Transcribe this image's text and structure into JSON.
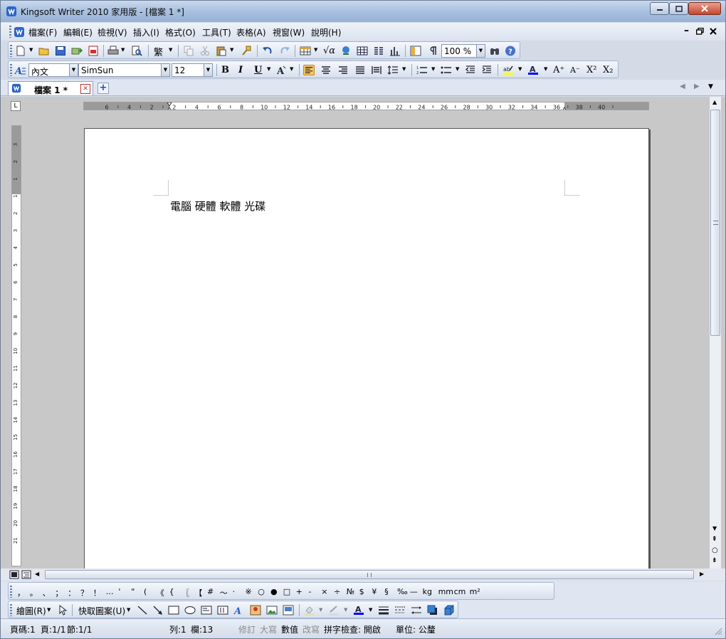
{
  "window": {
    "title": "Kingsoft Writer 2010 家用版 - [檔案 1 *]"
  },
  "menu": {
    "items": [
      "檔案(F)",
      "編輯(E)",
      "檢視(V)",
      "插入(I)",
      "格式(O)",
      "工具(T)",
      "表格(A)",
      "視窗(W)",
      "說明(H)"
    ]
  },
  "toolbar": {
    "zoom": "100 %",
    "trad_label": "繁"
  },
  "format": {
    "style": "內文",
    "font": "SimSun",
    "size": "12",
    "bold": "B",
    "italic": "I",
    "underline": "U",
    "grow": "A⁺",
    "shrink": "A⁻",
    "superscript": "X²",
    "subscript": "X₂"
  },
  "tab": {
    "label": "檔案 1  *"
  },
  "ruler": {
    "h_labels": [
      "6",
      "4",
      "2",
      "2",
      "4",
      "6",
      "8",
      "10",
      "12",
      "14",
      "16",
      "18",
      "20",
      "22",
      "24",
      "26",
      "28",
      "30",
      "32",
      "34",
      "36",
      "38",
      "40"
    ],
    "v_labels": [
      "3",
      "2",
      "1",
      "1",
      "2",
      "3",
      "4",
      "5",
      "6",
      "7",
      "8",
      "9",
      "10",
      "11",
      "12",
      "13",
      "14",
      "15",
      "16",
      "17",
      "18",
      "19",
      "20",
      "21"
    ]
  },
  "document": {
    "text": "電腦 硬體 軟體 光碟"
  },
  "symbols": [
    "，",
    "。",
    "、",
    "；",
    "：",
    "？",
    "！",
    "…",
    "'",
    "\"",
    "(",
    "《",
    "{",
    "〖",
    "【",
    "#",
    "～",
    "·",
    "※",
    "○",
    "●",
    "□",
    "+",
    "-",
    "×",
    "÷",
    "№",
    "$",
    "¥",
    "§",
    "‰",
    "—",
    "kg",
    "mm",
    "cm",
    "m²"
  ],
  "drawing": {
    "draw_label": "繪圖(R)",
    "autoshape_label": "快取圖案(U)"
  },
  "status": {
    "page_num": "頁碼:1",
    "page": "頁:1/1",
    "section": "節:1/1",
    "line": "列:1",
    "col": "欄:13",
    "revise": "修訂",
    "caps": "大寫",
    "num": "數值",
    "overwrite": "改寫",
    "spell": "拼字檢查: 開啟",
    "unit": "單位: 公釐"
  },
  "colors": {
    "highlight": "#ffff00",
    "font_color": "#0000ff",
    "title_gradient": "#a9c0df"
  }
}
